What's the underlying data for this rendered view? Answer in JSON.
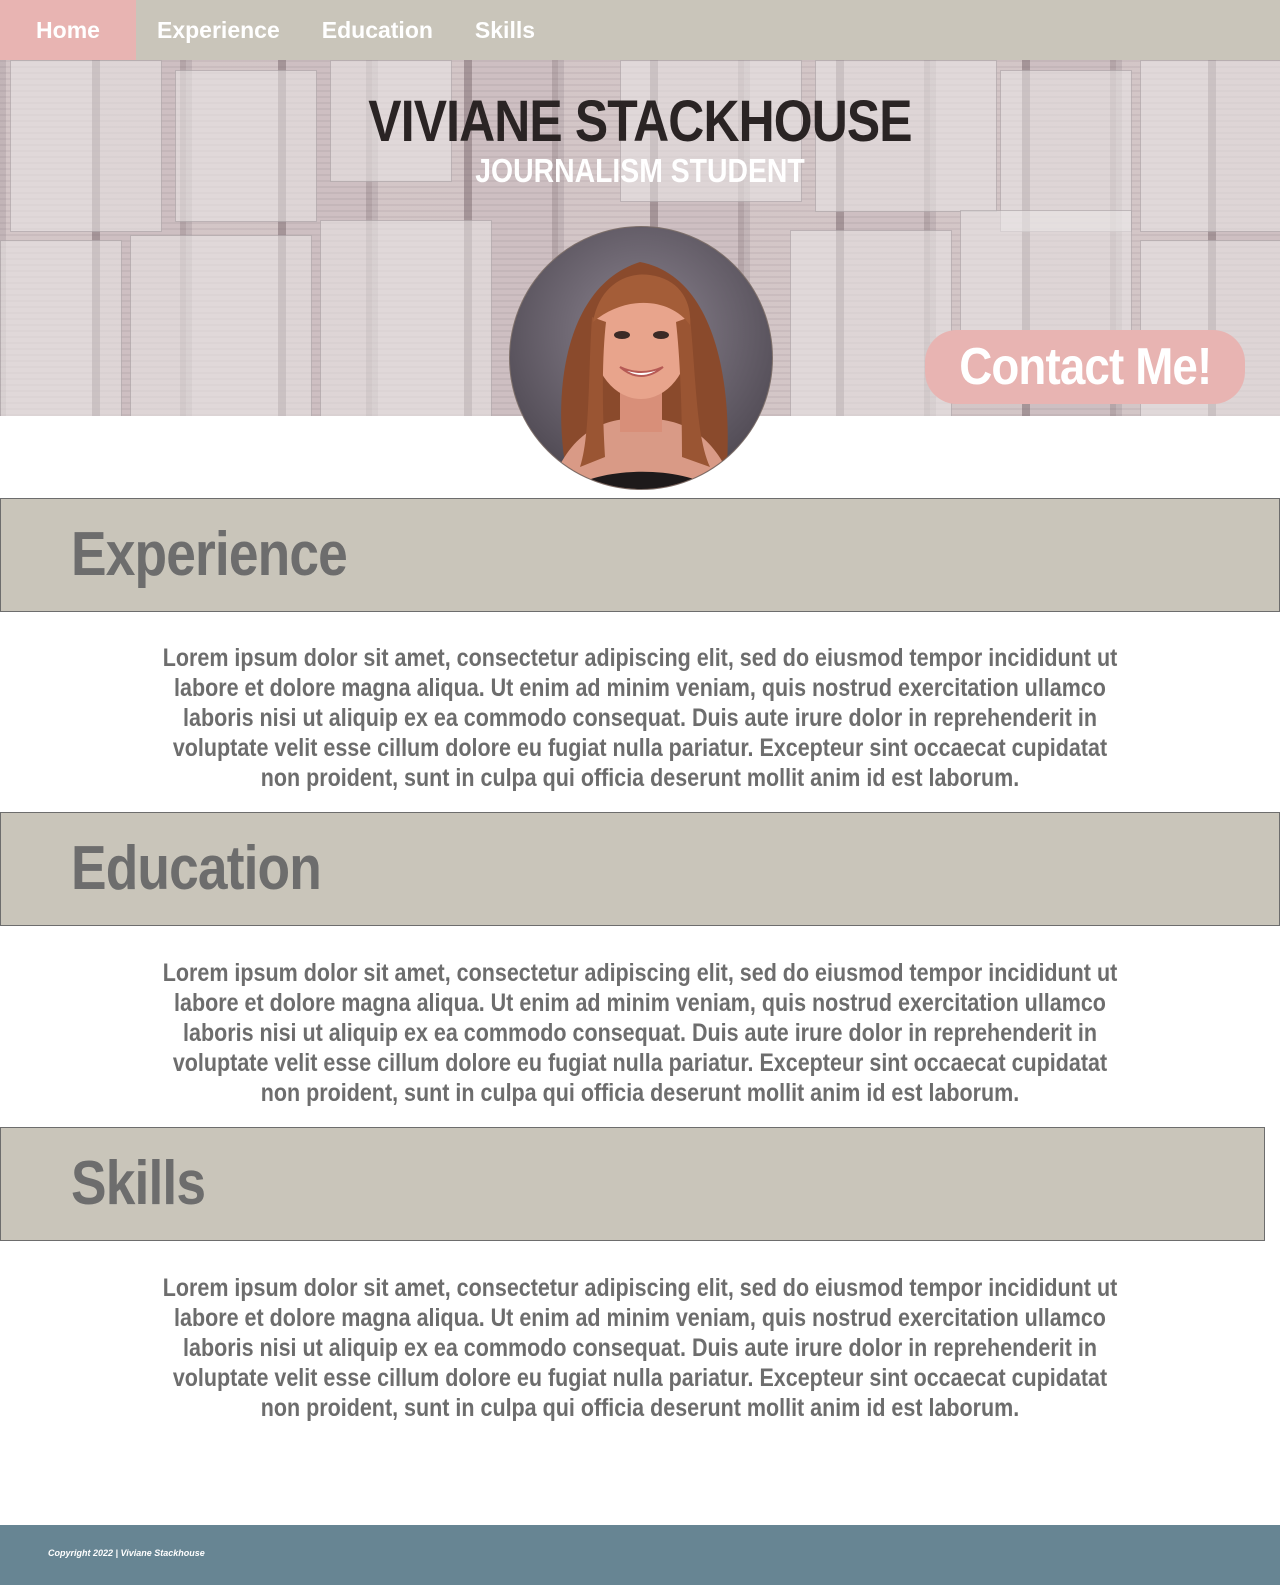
{
  "nav": {
    "items": [
      {
        "label": "Home",
        "active": true
      },
      {
        "label": "Experience",
        "active": false
      },
      {
        "label": "Education",
        "active": false
      },
      {
        "label": "Skills",
        "active": false
      }
    ]
  },
  "hero": {
    "name": "VIVIANE STACKHOUSE",
    "subtitle": "JOURNALISM STUDENT",
    "contact_label": "Contact Me!"
  },
  "sections": [
    {
      "title": "Experience",
      "body": "Lorem ipsum dolor sit amet, consectetur adipiscing elit, sed do eiusmod tempor incididunt ut labore et dolore magna aliqua. Ut enim ad minim veniam, quis nostrud exercitation ullamco laboris nisi ut aliquip ex ea commodo consequat. Duis aute irure dolor in reprehenderit in voluptate velit esse cillum dolore eu fugiat nulla pariatur. Excepteur sint occaecat cupidatat non proident, sunt in culpa qui officia deserunt mollit anim id est laborum."
    },
    {
      "title": "Education",
      "body": "Lorem ipsum dolor sit amet, consectetur adipiscing elit, sed do eiusmod tempor incididunt ut labore et dolore magna aliqua. Ut enim ad minim veniam, quis nostrud exercitation ullamco laboris nisi ut aliquip ex ea commodo consequat. Duis aute irure dolor in reprehenderit in voluptate velit esse cillum dolore eu fugiat nulla pariatur. Excepteur sint occaecat cupidatat non proident, sunt in culpa qui officia deserunt mollit anim id est laborum."
    },
    {
      "title": "Skills",
      "body": "Lorem ipsum dolor sit amet, consectetur adipiscing elit, sed do eiusmod tempor incididunt ut labore et dolore magna aliqua. Ut enim ad minim veniam, quis nostrud exercitation ullamco laboris nisi ut aliquip ex ea commodo consequat. Duis aute irure dolor in reprehenderit in voluptate velit esse cillum dolore eu fugiat nulla pariatur. Excepteur sint occaecat cupidatat non proident, sunt in culpa qui officia deserunt mollit anim id est laborum."
    }
  ],
  "footer": {
    "copyright": "Copyright 2022 | Viviane Stackhouse"
  },
  "colors": {
    "nav_bg": "#c9c5ba",
    "accent_pink": "#e8b4b2",
    "section_bar": "#c9c5ba",
    "text_gray": "#6d6d6d",
    "footer_bg": "#678593"
  }
}
